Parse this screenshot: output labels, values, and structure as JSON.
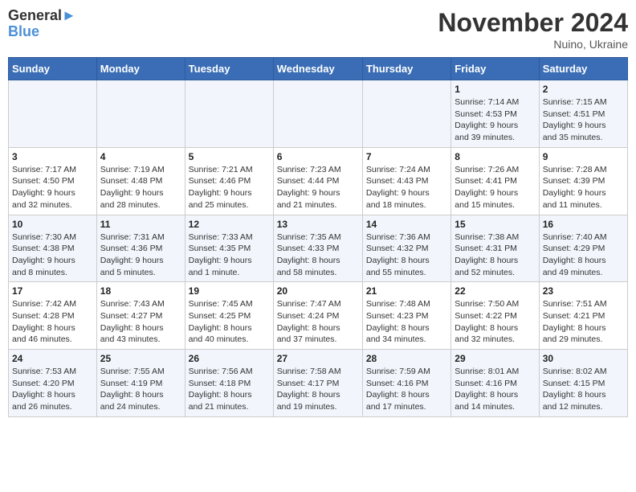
{
  "header": {
    "logo_line1": "General",
    "logo_line2": "Blue",
    "month": "November 2024",
    "location": "Nuino, Ukraine"
  },
  "weekdays": [
    "Sunday",
    "Monday",
    "Tuesday",
    "Wednesday",
    "Thursday",
    "Friday",
    "Saturday"
  ],
  "weeks": [
    [
      {
        "day": "",
        "info": ""
      },
      {
        "day": "",
        "info": ""
      },
      {
        "day": "",
        "info": ""
      },
      {
        "day": "",
        "info": ""
      },
      {
        "day": "",
        "info": ""
      },
      {
        "day": "1",
        "info": "Sunrise: 7:14 AM\nSunset: 4:53 PM\nDaylight: 9 hours\nand 39 minutes."
      },
      {
        "day": "2",
        "info": "Sunrise: 7:15 AM\nSunset: 4:51 PM\nDaylight: 9 hours\nand 35 minutes."
      }
    ],
    [
      {
        "day": "3",
        "info": "Sunrise: 7:17 AM\nSunset: 4:50 PM\nDaylight: 9 hours\nand 32 minutes."
      },
      {
        "day": "4",
        "info": "Sunrise: 7:19 AM\nSunset: 4:48 PM\nDaylight: 9 hours\nand 28 minutes."
      },
      {
        "day": "5",
        "info": "Sunrise: 7:21 AM\nSunset: 4:46 PM\nDaylight: 9 hours\nand 25 minutes."
      },
      {
        "day": "6",
        "info": "Sunrise: 7:23 AM\nSunset: 4:44 PM\nDaylight: 9 hours\nand 21 minutes."
      },
      {
        "day": "7",
        "info": "Sunrise: 7:24 AM\nSunset: 4:43 PM\nDaylight: 9 hours\nand 18 minutes."
      },
      {
        "day": "8",
        "info": "Sunrise: 7:26 AM\nSunset: 4:41 PM\nDaylight: 9 hours\nand 15 minutes."
      },
      {
        "day": "9",
        "info": "Sunrise: 7:28 AM\nSunset: 4:39 PM\nDaylight: 9 hours\nand 11 minutes."
      }
    ],
    [
      {
        "day": "10",
        "info": "Sunrise: 7:30 AM\nSunset: 4:38 PM\nDaylight: 9 hours\nand 8 minutes."
      },
      {
        "day": "11",
        "info": "Sunrise: 7:31 AM\nSunset: 4:36 PM\nDaylight: 9 hours\nand 5 minutes."
      },
      {
        "day": "12",
        "info": "Sunrise: 7:33 AM\nSunset: 4:35 PM\nDaylight: 9 hours\nand 1 minute."
      },
      {
        "day": "13",
        "info": "Sunrise: 7:35 AM\nSunset: 4:33 PM\nDaylight: 8 hours\nand 58 minutes."
      },
      {
        "day": "14",
        "info": "Sunrise: 7:36 AM\nSunset: 4:32 PM\nDaylight: 8 hours\nand 55 minutes."
      },
      {
        "day": "15",
        "info": "Sunrise: 7:38 AM\nSunset: 4:31 PM\nDaylight: 8 hours\nand 52 minutes."
      },
      {
        "day": "16",
        "info": "Sunrise: 7:40 AM\nSunset: 4:29 PM\nDaylight: 8 hours\nand 49 minutes."
      }
    ],
    [
      {
        "day": "17",
        "info": "Sunrise: 7:42 AM\nSunset: 4:28 PM\nDaylight: 8 hours\nand 46 minutes."
      },
      {
        "day": "18",
        "info": "Sunrise: 7:43 AM\nSunset: 4:27 PM\nDaylight: 8 hours\nand 43 minutes."
      },
      {
        "day": "19",
        "info": "Sunrise: 7:45 AM\nSunset: 4:25 PM\nDaylight: 8 hours\nand 40 minutes."
      },
      {
        "day": "20",
        "info": "Sunrise: 7:47 AM\nSunset: 4:24 PM\nDaylight: 8 hours\nand 37 minutes."
      },
      {
        "day": "21",
        "info": "Sunrise: 7:48 AM\nSunset: 4:23 PM\nDaylight: 8 hours\nand 34 minutes."
      },
      {
        "day": "22",
        "info": "Sunrise: 7:50 AM\nSunset: 4:22 PM\nDaylight: 8 hours\nand 32 minutes."
      },
      {
        "day": "23",
        "info": "Sunrise: 7:51 AM\nSunset: 4:21 PM\nDaylight: 8 hours\nand 29 minutes."
      }
    ],
    [
      {
        "day": "24",
        "info": "Sunrise: 7:53 AM\nSunset: 4:20 PM\nDaylight: 8 hours\nand 26 minutes."
      },
      {
        "day": "25",
        "info": "Sunrise: 7:55 AM\nSunset: 4:19 PM\nDaylight: 8 hours\nand 24 minutes."
      },
      {
        "day": "26",
        "info": "Sunrise: 7:56 AM\nSunset: 4:18 PM\nDaylight: 8 hours\nand 21 minutes."
      },
      {
        "day": "27",
        "info": "Sunrise: 7:58 AM\nSunset: 4:17 PM\nDaylight: 8 hours\nand 19 minutes."
      },
      {
        "day": "28",
        "info": "Sunrise: 7:59 AM\nSunset: 4:16 PM\nDaylight: 8 hours\nand 17 minutes."
      },
      {
        "day": "29",
        "info": "Sunrise: 8:01 AM\nSunset: 4:16 PM\nDaylight: 8 hours\nand 14 minutes."
      },
      {
        "day": "30",
        "info": "Sunrise: 8:02 AM\nSunset: 4:15 PM\nDaylight: 8 hours\nand 12 minutes."
      }
    ]
  ]
}
